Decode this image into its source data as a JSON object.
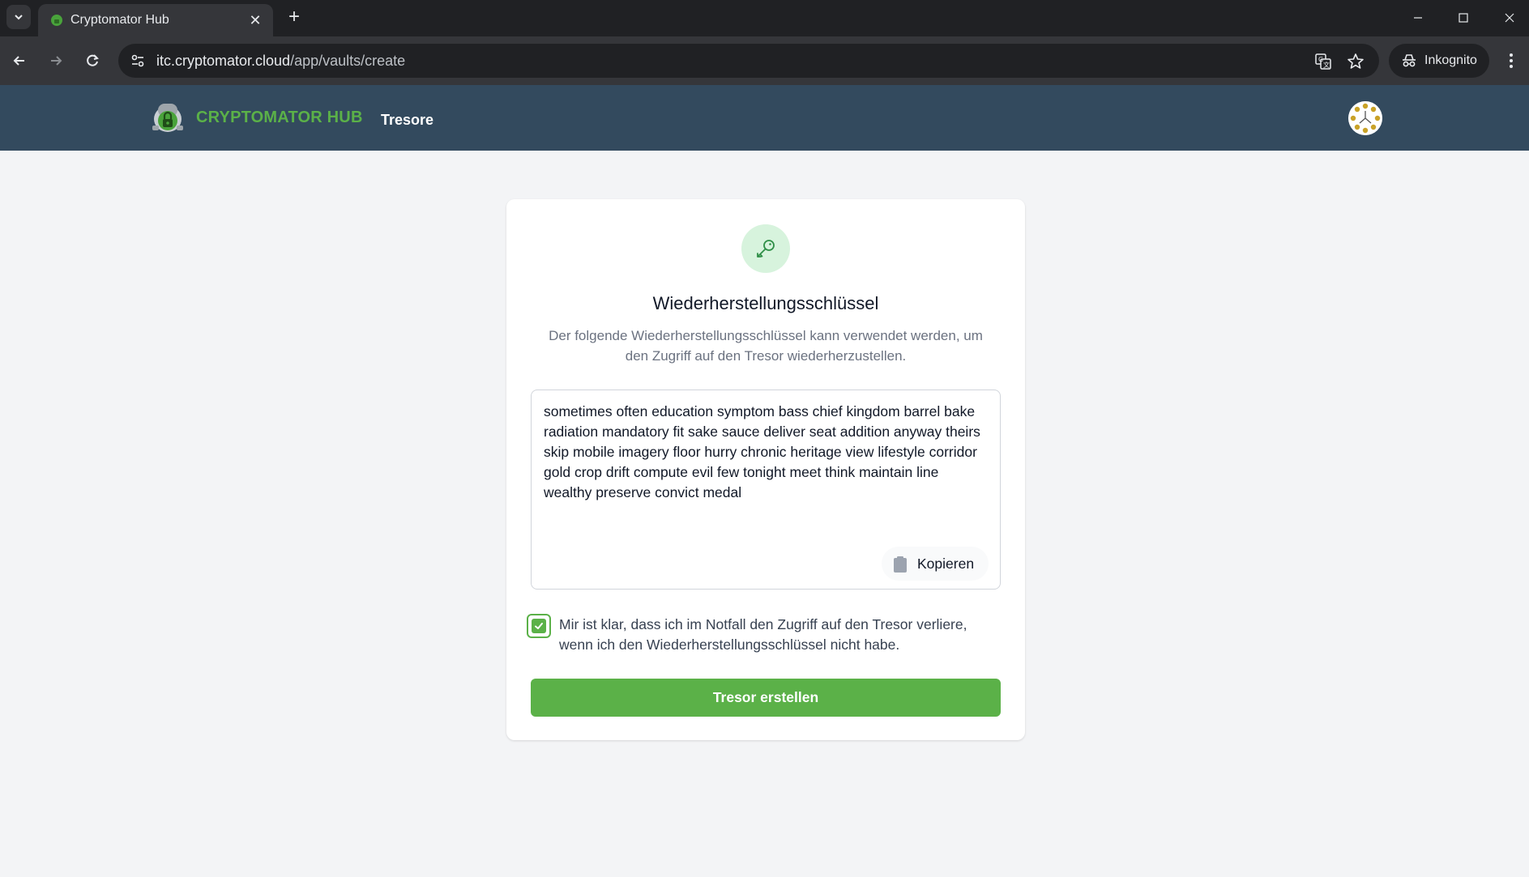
{
  "browser": {
    "tab_title": "Cryptomator Hub",
    "url_host": "itc.cryptomator.cloud",
    "url_path": "/app/vaults/create",
    "incognito_label": "Inkognito",
    "tab_close": "✕",
    "new_tab": "+"
  },
  "header": {
    "brand": "CRYPTOMATOR HUB",
    "nav_vaults": "Tresore"
  },
  "card": {
    "title": "Wiederherstellungsschlüssel",
    "description": "Der folgende Wiederherstellungsschlüssel kann verwendet werden, um den Zugriff auf den Tresor wiederherzustellen.",
    "recovery_key": "sometimes often education symptom bass chief kingdom barrel bake radiation mandatory fit sake sauce deliver seat addition anyway theirs skip mobile imagery floor hurry chronic heritage view lifestyle corridor gold crop drift compute evil few tonight meet think maintain line wealthy preserve convict medal",
    "copy_label": "Kopieren",
    "confirm_label": "Mir ist klar, dass ich im Notfall den Zugriff auf den Tresor verliere, wenn ich den Wiederherstellungsschlüssel nicht habe.",
    "confirm_checked": true,
    "create_button": "Tresor erstellen"
  },
  "colors": {
    "accent_green": "#5bb148",
    "header_bg": "#334a5e",
    "page_bg": "#f3f4f6"
  },
  "icons": [
    "chevron-down-icon",
    "cryptomator-favicon",
    "close-icon",
    "plus-icon",
    "minimize-icon",
    "maximize-icon",
    "window-close-icon",
    "back-arrow-icon",
    "forward-arrow-icon",
    "reload-icon",
    "site-settings-icon",
    "translate-icon",
    "star-icon",
    "incognito-icon",
    "more-vert-icon",
    "cryptomator-logo-icon",
    "avatar-identicon",
    "key-icon",
    "clipboard-icon",
    "checkmark-icon"
  ]
}
